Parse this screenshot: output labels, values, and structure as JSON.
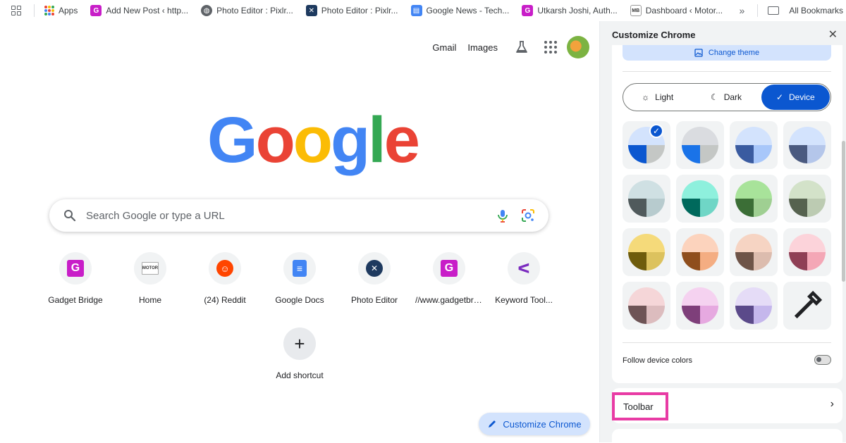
{
  "bookmarks": {
    "items": [
      {
        "label": "Apps",
        "icon": "apps-icon"
      },
      {
        "label": "Add New Post ‹ http...",
        "icon": "gadgetbridge-icon"
      },
      {
        "label": "Photo Editor : Pixlr...",
        "icon": "globe-icon"
      },
      {
        "label": "Photo Editor : Pixlr...",
        "icon": "pixlr-icon"
      },
      {
        "label": "Google News - Tech...",
        "icon": "google-news-icon"
      },
      {
        "label": "Utkarsh Joshi, Auth...",
        "icon": "gadgetbridge-icon"
      },
      {
        "label": "Dashboard ‹ Motor...",
        "icon": "motorbridge-icon"
      }
    ],
    "overflow": "»",
    "all_bookmarks": "All Bookmarks"
  },
  "ntp": {
    "links": {
      "gmail": "Gmail",
      "images": "Images"
    },
    "logo": {
      "g1": "G",
      "o1": "o",
      "o2": "o",
      "g2": "g",
      "l": "l",
      "e": "e"
    },
    "search_placeholder": "Search Google or type a URL",
    "shortcuts": [
      {
        "label": "Gadget Bridge",
        "icon": "gadgetbridge-icon"
      },
      {
        "label": "Home",
        "icon": "motorbridge-icon"
      },
      {
        "label": "(24) Reddit",
        "icon": "reddit-icon"
      },
      {
        "label": "Google Docs",
        "icon": "google-docs-icon"
      },
      {
        "label": "Photo Editor",
        "icon": "pixlr-icon"
      },
      {
        "label": "//www.gadgetbridge.com",
        "icon": "gadgetbridge-icon"
      },
      {
        "label": "Keyword Tool...",
        "icon": "keyword-tool-icon"
      }
    ],
    "add_shortcut": "Add shortcut",
    "customize_button": "Customize Chrome"
  },
  "panel": {
    "title": "Customize Chrome",
    "change_theme": "Change theme",
    "modes": {
      "light": "Light",
      "dark": "Dark",
      "device": "Device"
    },
    "selected_mode": "Device",
    "follow_device_colors": "Follow device colors",
    "toolbar": "Toolbar"
  },
  "colors": {
    "accent": "#0b57d0",
    "accent_light": "#d3e3fd",
    "highlight_border": "#e83ba4",
    "swatches": [
      {
        "top": "#d3e3fd",
        "left": "#0b57d0",
        "right": "#c4c7c5"
      },
      {
        "top": "#dadce0",
        "left": "#1a73e8",
        "right": "#c4c7c5"
      },
      {
        "top": "#d3e3fd",
        "left": "#3a5ba0",
        "right": "#a8c7fa"
      },
      {
        "top": "#d3e3fd",
        "left": "#4a5a80",
        "right": "#b4c6ea"
      },
      {
        "top": "#cfe0e3",
        "left": "#505a5c",
        "right": "#b7cbce"
      },
      {
        "top": "#8ef0dd",
        "left": "#00695c",
        "right": "#6fd6c6"
      },
      {
        "top": "#a8e39a",
        "left": "#3b6e36",
        "right": "#9fcf92"
      },
      {
        "top": "#d3e2c9",
        "left": "#56624f",
        "right": "#bccbb2"
      },
      {
        "top": "#f5da7a",
        "left": "#6e5c0c",
        "right": "#dcc25e"
      },
      {
        "top": "#fcd3bd",
        "left": "#8f4e1d",
        "right": "#f4ad82"
      },
      {
        "top": "#f6d4c3",
        "left": "#6e5448",
        "right": "#dcbcae"
      },
      {
        "top": "#fcd3da",
        "left": "#8f3f55",
        "right": "#f4a7b6"
      },
      {
        "top": "#f5d6d8",
        "left": "#6e5456",
        "right": "#dcbcbe"
      },
      {
        "top": "#f5d2f0",
        "left": "#7e3f7a",
        "right": "#e6a9e0"
      },
      {
        "top": "#e5dcf7",
        "left": "#5b4a8a",
        "right": "#c5b7ec"
      }
    ]
  }
}
